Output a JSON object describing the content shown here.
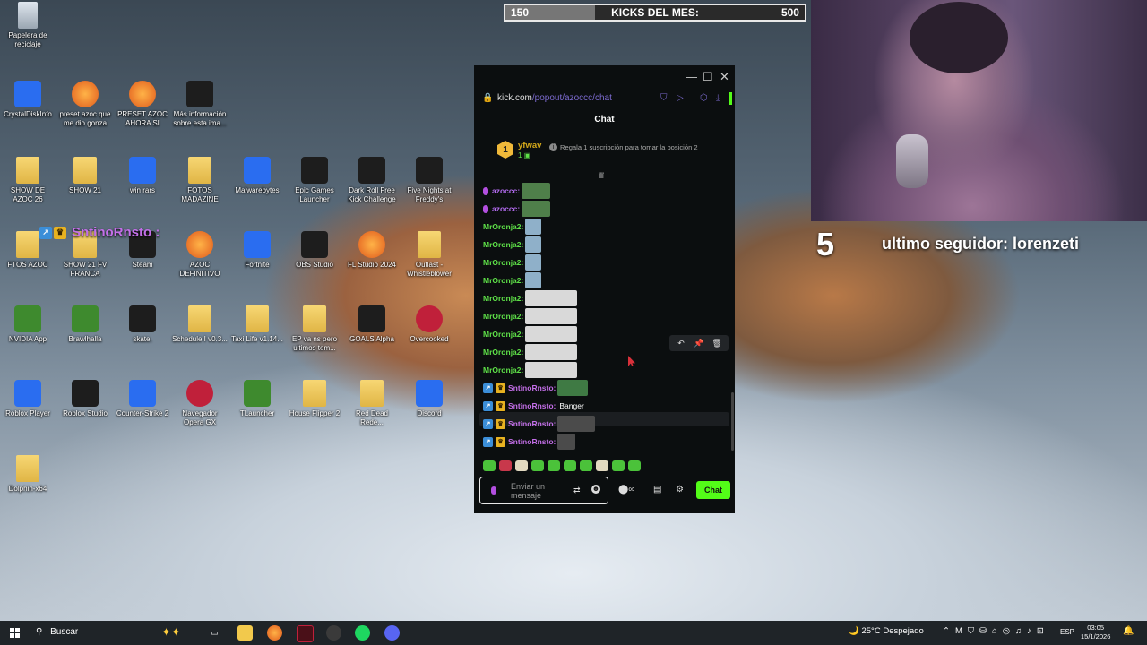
{
  "desktop": {
    "icons": [
      {
        "label": "Papelera de reciclaje",
        "icon": "recycle-bin-icon"
      },
      {
        "label": "CrystalDiskInfo",
        "icon": "crystaldiskinfo-icon"
      },
      {
        "label": "preset azoc que me dio gonza",
        "icon": "fl-studio-icon"
      },
      {
        "label": "PRESET AZOC AHORA SI",
        "icon": "fl-studio-icon"
      },
      {
        "label": "Más información sobre esta ima...",
        "icon": "info-icon"
      },
      {
        "label": "SHOW DE AZOC 26",
        "icon": "folder-icon"
      },
      {
        "label": "SHOW 21",
        "icon": "folder-icon"
      },
      {
        "label": "win rars",
        "icon": "winrar-icon"
      },
      {
        "label": "FOTOS MADAZINE",
        "icon": "folder-icon"
      },
      {
        "label": "Malwarebytes",
        "icon": "malwarebytes-icon"
      },
      {
        "label": "Epic Games Launcher",
        "icon": "epic-games-icon"
      },
      {
        "label": "Dark Roll Free Kick Challenge",
        "icon": "soccer-ball-icon"
      },
      {
        "label": "Five Nights at Freddy's",
        "icon": "fnaf-icon"
      },
      {
        "label": "FTOS AZOC",
        "icon": "folder-icon"
      },
      {
        "label": "SHOW 21 FV FRANCA",
        "icon": "folder-icon"
      },
      {
        "label": "Steam",
        "icon": "person-icon"
      },
      {
        "label": "AZOC DEFINITIVO",
        "icon": "fl-studio-icon"
      },
      {
        "label": "Fortnite",
        "icon": "fortnite-icon"
      },
      {
        "label": "OBS Studio",
        "icon": "obs-icon"
      },
      {
        "label": "FL Studio 2024",
        "icon": "fl-studio-icon"
      },
      {
        "label": "Outlast - Whistleblower",
        "icon": "file-icon"
      },
      {
        "label": "NVIDIA App",
        "icon": "nvidia-icon"
      },
      {
        "label": "Brawlhalla",
        "icon": "brawlhalla-icon"
      },
      {
        "label": "skate.",
        "icon": "skate-icon"
      },
      {
        "label": "Schedule I v0.3...",
        "icon": "file-icon"
      },
      {
        "label": "Taxi Life v1.14...",
        "icon": "file-icon"
      },
      {
        "label": "EP va ns pero ultimos tem...",
        "icon": "folder-icon"
      },
      {
        "label": "GOALS Alpha",
        "icon": "goals-icon"
      },
      {
        "label": "Overcooked",
        "icon": "overcooked-icon"
      },
      {
        "label": "Roblox Player",
        "icon": "roblox-icon"
      },
      {
        "label": "Roblox Studio",
        "icon": "roblox-studio-icon"
      },
      {
        "label": "Counter-Strike 2",
        "icon": "cs2-icon"
      },
      {
        "label": "Navegador Opera GX",
        "icon": "opera-gx-icon"
      },
      {
        "label": "TLauncher",
        "icon": "minecraft-icon"
      },
      {
        "label": "House Flipper 2",
        "icon": "file-icon"
      },
      {
        "label": "Red Dead Rede...",
        "icon": "file-icon"
      },
      {
        "label": "Discord",
        "icon": "discord-icon"
      },
      {
        "label": "Dolphin-x64",
        "icon": "file-icon"
      }
    ],
    "floating_user": "SntinoRnsto :"
  },
  "overlay": {
    "kicks_current": "150",
    "kicks_title": "KICKS DEL MES:",
    "kicks_goal": "500",
    "kicks_progress": 0.3,
    "follower_number": "5",
    "follower_text": "ultimo seguidor: lorenzeti"
  },
  "chat_window": {
    "url_domain": "kick.com",
    "url_path": "/popout/azoccc/chat",
    "title": "Chat",
    "pinned": {
      "rank": "1",
      "username": "yfwav",
      "count": "1",
      "text": "Regala 1 suscripción para tomar la posición 2"
    },
    "messages": [
      {
        "user": "azoccc:",
        "color": "#b56cf2",
        "type": "mic",
        "content": ""
      },
      {
        "user": "azoccc:",
        "color": "#b56cf2",
        "type": "mic",
        "content": ""
      },
      {
        "user": "MrOronja2:",
        "color": "#5ee048",
        "type": "plain",
        "content": ""
      },
      {
        "user": "MrOronja2:",
        "color": "#5ee048",
        "type": "plain",
        "content": ""
      },
      {
        "user": "MrOronja2:",
        "color": "#5ee048",
        "type": "plain",
        "content": ""
      },
      {
        "user": "MrOronja2:",
        "color": "#5ee048",
        "type": "plain",
        "content": ""
      },
      {
        "user": "MrOronja2:",
        "color": "#5ee048",
        "type": "plain",
        "content": ""
      },
      {
        "user": "MrOronja2:",
        "color": "#5ee048",
        "type": "plain",
        "content": ""
      },
      {
        "user": "MrOronja2:",
        "color": "#5ee048",
        "type": "plain",
        "content": ""
      },
      {
        "user": "MrOronja2:",
        "color": "#5ee048",
        "type": "plain",
        "content": ""
      },
      {
        "user": "MrOronja2:",
        "color": "#5ee048",
        "type": "plain",
        "content": ""
      },
      {
        "user": "SntinoRnsto:",
        "color": "#c46fe9",
        "type": "badges",
        "content": ""
      },
      {
        "user": "SntinoRnsto:",
        "color": "#c46fe9",
        "type": "badges",
        "content": "Banger"
      },
      {
        "user": "SntinoRnsto:",
        "color": "#c46fe9",
        "type": "badges",
        "content": ""
      },
      {
        "user": "SntinoRnsto:",
        "color": "#c46fe9",
        "type": "badges",
        "content": ""
      }
    ],
    "input_placeholder": "Enviar un mensaje",
    "send_label": "Chat"
  },
  "taskbar": {
    "search_label": "Buscar",
    "weather": "25°C  Despejado",
    "language": "ESP",
    "time": "03:05",
    "date": "15/1/2026"
  }
}
